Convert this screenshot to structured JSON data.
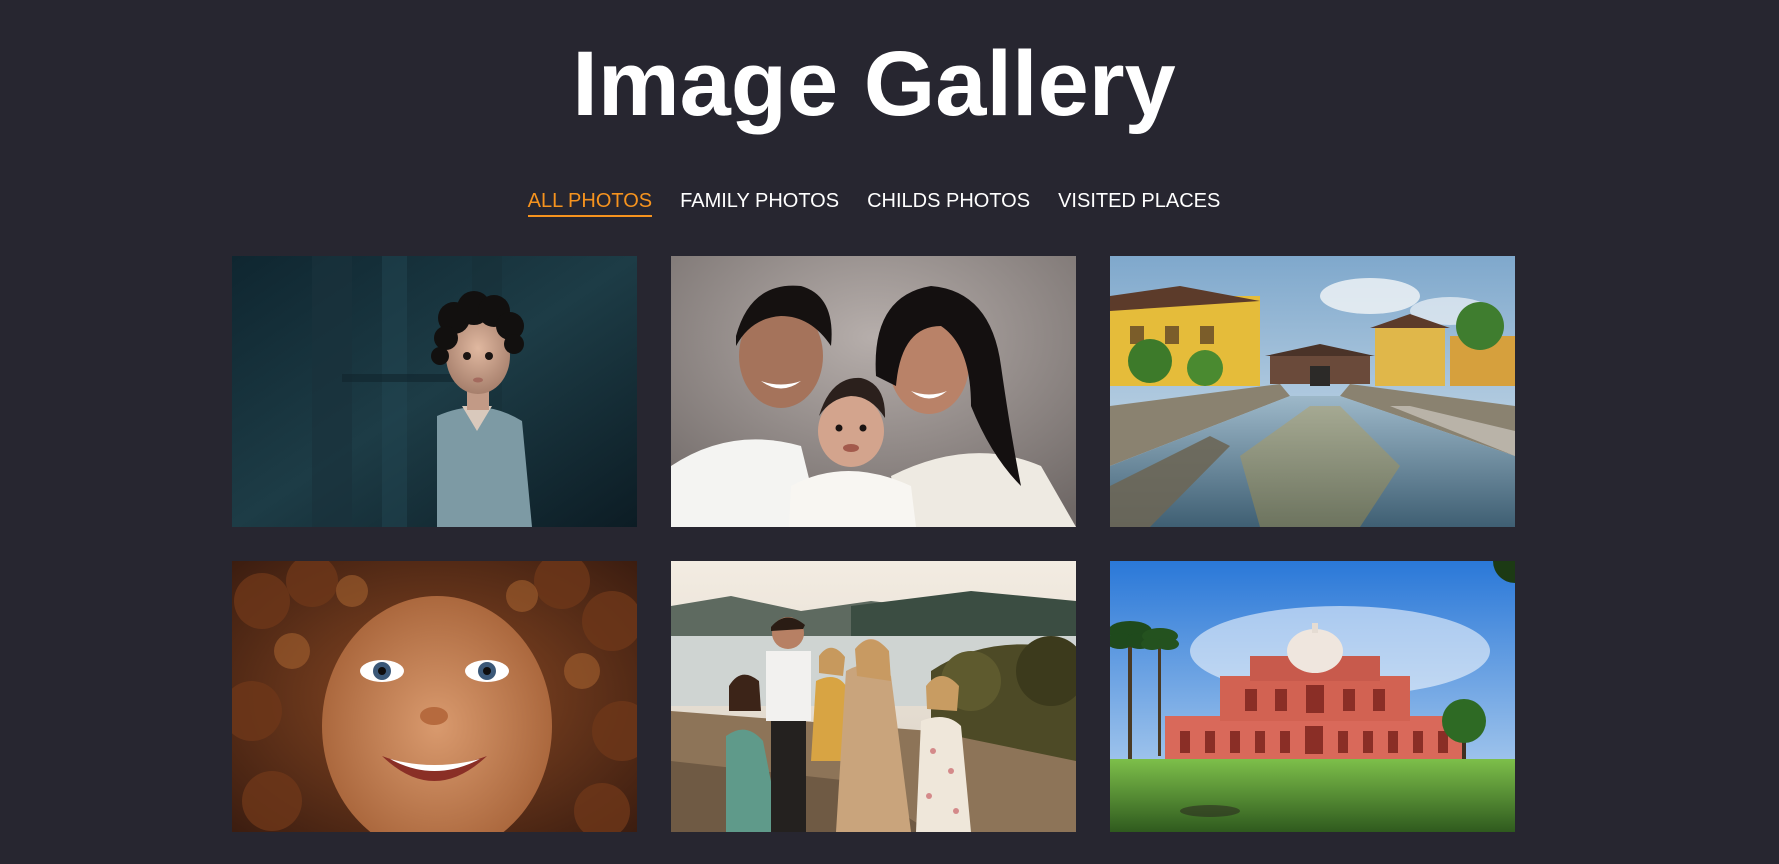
{
  "header": {
    "title": "Image Gallery"
  },
  "filters": [
    {
      "label": "ALL PHOTOS",
      "active": true
    },
    {
      "label": "FAMILY PHOTOS",
      "active": false
    },
    {
      "label": "CHILDS PHOTOS",
      "active": false
    },
    {
      "label": "VISITED PLACES",
      "active": false
    }
  ],
  "colors": {
    "background": "#272630",
    "accent": "#f6931e",
    "text": "#ffffff"
  },
  "gallery": {
    "photos": [
      {
        "name": "child-curly-hair-photo",
        "category": "CHILDS PHOTOS"
      },
      {
        "name": "family-portrait-photo",
        "category": "FAMILY PHOTOS"
      },
      {
        "name": "canal-bridge-town-photo",
        "category": "VISITED PLACES"
      },
      {
        "name": "smiling-curly-child-photo",
        "category": "CHILDS PHOTOS"
      },
      {
        "name": "family-lakeside-photo",
        "category": "FAMILY PHOTOS"
      },
      {
        "name": "domed-monument-photo",
        "category": "VISITED PLACES"
      }
    ]
  }
}
